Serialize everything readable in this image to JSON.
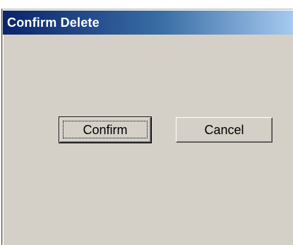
{
  "dialog": {
    "title": "Confirm Delete",
    "confirm_label": "Confirm",
    "cancel_label": "Cancel"
  },
  "colors": {
    "titlebar_start": "#0a246a",
    "titlebar_end": "#a6caf0",
    "window_face": "#d4d0c8"
  }
}
